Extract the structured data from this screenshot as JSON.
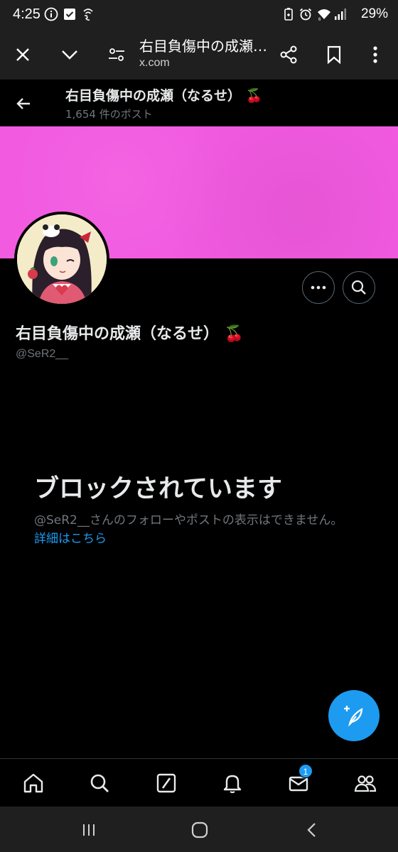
{
  "status_bar": {
    "time": "4:25",
    "battery": "29%",
    "left_icons": [
      "info-icon",
      "check-box-icon",
      "wifi-calling-icon"
    ],
    "right_icons": [
      "battery-saver-icon",
      "alarm-icon",
      "wifi-icon",
      "signal-icon"
    ]
  },
  "browser": {
    "page_title": "右目負傷中の成瀬…",
    "url": "x.com",
    "icons": [
      "close-icon",
      "chevron-down-icon",
      "tune-icon",
      "share-icon",
      "bookmark-icon",
      "more-vert-icon"
    ]
  },
  "profile_header": {
    "name": "右目負傷中の成瀬（なるせ）",
    "emoji": "🍒",
    "post_count": "1,654 件のポスト"
  },
  "profile": {
    "name": "右目負傷中の成瀬（なるせ）",
    "emoji": "🍒",
    "handle": "@SeR2__",
    "banner_color": "#f25ae0"
  },
  "blocked": {
    "title": "ブロックされています",
    "description": "@SeR2__さんのフォローやポストの表示はできません。",
    "link": "詳細はこちら"
  },
  "tab_bar": {
    "tabs": [
      "home-icon",
      "search-icon",
      "grok-icon",
      "notifications-icon",
      "messages-icon",
      "communities-icon"
    ],
    "messages_badge": "1"
  },
  "colors": {
    "accent": "#1d9bf0",
    "background": "#000000",
    "secondary_text": "#71767b"
  }
}
